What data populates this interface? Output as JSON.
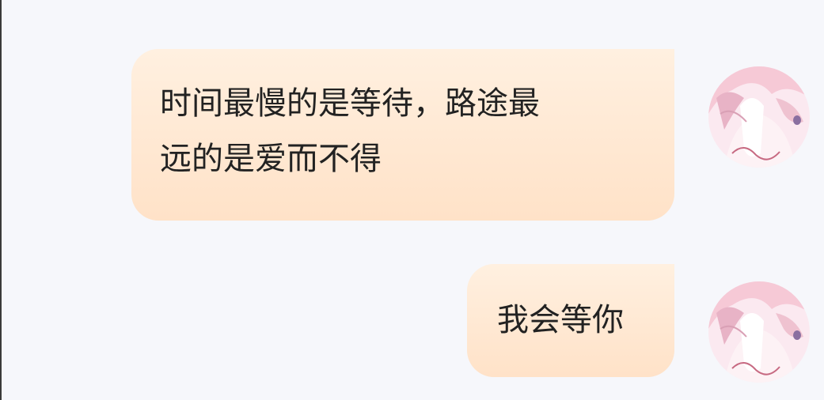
{
  "messages": [
    {
      "text_line1": "时间最慢的是等待，路途最",
      "text_line2": "远的是爱而不得"
    },
    {
      "text": "我会等你"
    }
  ],
  "colors": {
    "background": "#f6f7fb",
    "bubble": "#ffe8d4",
    "text": "#222222"
  },
  "avatar_icon": "anime-girl-avatar-icon"
}
